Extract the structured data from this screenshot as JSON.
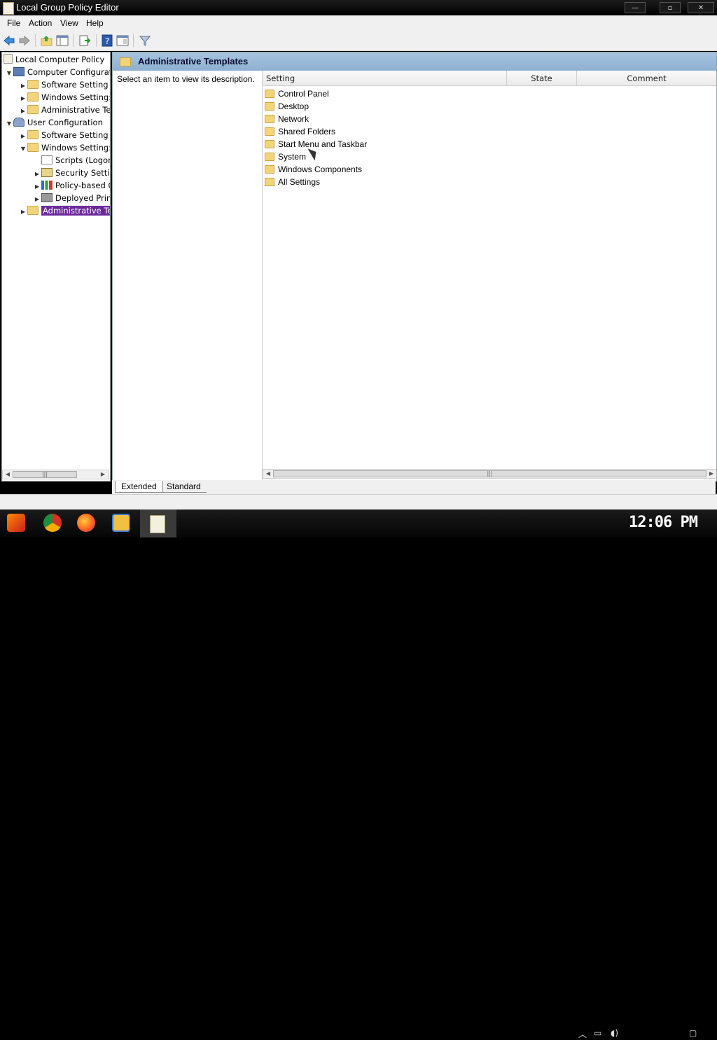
{
  "window": {
    "title": "Local Group Policy Editor",
    "controls": {
      "minimize": "—",
      "maximize": "▫",
      "close": "✕"
    }
  },
  "menu": [
    "File",
    "Action",
    "View",
    "Help"
  ],
  "toolbar": {
    "icons": [
      "back-arrow-icon",
      "forward-arrow-icon",
      "up-folder-icon",
      "show-hide-tree-icon",
      "export-list-icon",
      "help-icon",
      "properties-icon",
      "filter-icon"
    ]
  },
  "tree": {
    "root": "Local Computer Policy",
    "computer_configuration": "Computer Configurati",
    "cc_software_settings": "Software Setting",
    "cc_windows_settings": "Windows Setting:",
    "cc_admin_templates": "Administrative Te",
    "user_configuration": "User Configuration",
    "uc_software_settings": "Software Setting",
    "uc_windows_settings": "Windows Setting:",
    "scripts": "Scripts (Logon",
    "security_settings": "Security Setti",
    "policy_based": "Policy-based C",
    "deployed_printers": "Deployed Prin",
    "uc_admin_templates": "Administrative Te"
  },
  "pane": {
    "title": "Administrative Templates",
    "description": "Select an item to view its description."
  },
  "list": {
    "columns": {
      "setting": "Setting",
      "state": "State",
      "comment": "Comment"
    },
    "items": [
      "Control Panel",
      "Desktop",
      "Network",
      "Shared Folders",
      "Start Menu and Taskbar",
      "System",
      "Windows Components",
      "All Settings"
    ]
  },
  "tabs": {
    "extended": "Extended",
    "standard": "Standard"
  },
  "taskbar": {
    "clock": "12:06 PM",
    "apps": [
      "start-button",
      "chrome-icon",
      "firefox-icon",
      "file-explorer-icon",
      "group-policy-editor-icon"
    ]
  },
  "colors": {
    "selection": "#6a2a9c",
    "header": "#8fb0d2",
    "folder": "#f2d47a"
  }
}
